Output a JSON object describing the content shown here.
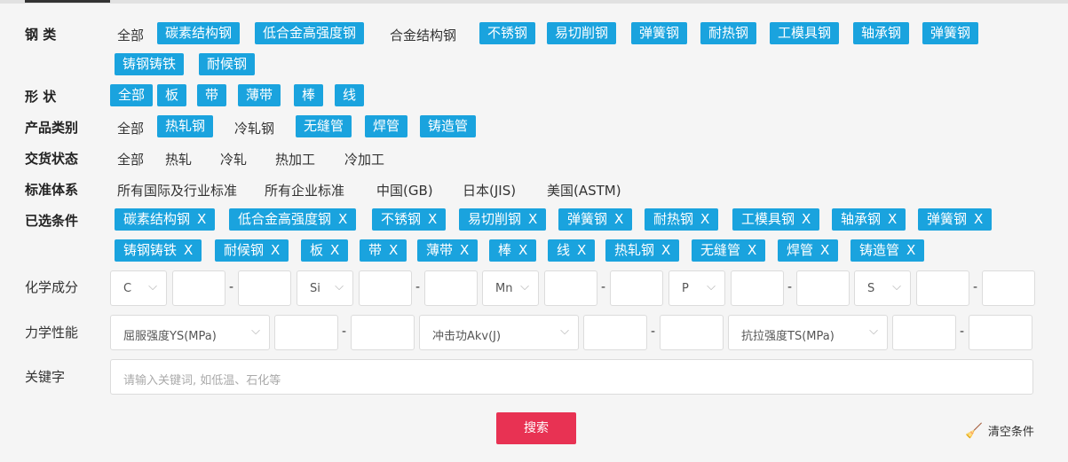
{
  "steel": {
    "label": "钢    类",
    "all": "全部",
    "plain": [
      "合金结构钢"
    ],
    "tags": [
      "碳素结构钢",
      "低合金高强度钢",
      "不锈钢",
      "易切削钢",
      "弹簧钢",
      "耐热钢",
      "工模具钢",
      "轴承钢",
      "弹簧钢",
      "铸钢铸铁",
      "耐候钢"
    ]
  },
  "shape": {
    "label": "形    状",
    "tags": [
      "全部",
      "板",
      "带",
      "薄带",
      "棒",
      "线"
    ]
  },
  "product": {
    "label": "产品类别",
    "all": "全部",
    "hot": "热轧钢",
    "cold": "冷轧钢",
    "tags": [
      "无缝管",
      "焊管",
      "铸造管"
    ]
  },
  "delivery": {
    "label": "交货状态",
    "options": [
      "全部",
      "热轧",
      "冷轧",
      "热加工",
      "冷加工"
    ]
  },
  "standard": {
    "label": "标准体系",
    "options": [
      "所有国际及行业标准",
      "所有企业标准",
      "中国(GB)",
      "日本(JIS)",
      "美国(ASTM)"
    ]
  },
  "selected": {
    "label": "已选条件",
    "close": "X",
    "chips": [
      "碳素结构钢",
      "低合金高强度钢",
      "不锈钢",
      "易切削钢",
      "弹簧钢",
      "耐热钢",
      "工模具钢",
      "轴承钢",
      "弹簧钢",
      "铸钢铸铁",
      "耐候钢",
      "板",
      "带",
      "薄带",
      "棒",
      "线",
      "热轧钢",
      "无缝管",
      "焊管",
      "铸造管"
    ]
  },
  "chem": {
    "label": "化学成分",
    "elements": [
      "C",
      "Si",
      "Mn",
      "P",
      "S"
    ],
    "dash": "-"
  },
  "mech": {
    "label": "力学性能",
    "props": [
      "屈服强度YS(MPa)",
      "冲击功Akv(J)",
      "抗拉强度TS(MPa)"
    ],
    "dash": "-"
  },
  "keyword": {
    "label": "关键字",
    "placeholder": "请输入关键词, 如低温、石化等"
  },
  "actions": {
    "search": "搜索",
    "clear": "清空条件"
  }
}
